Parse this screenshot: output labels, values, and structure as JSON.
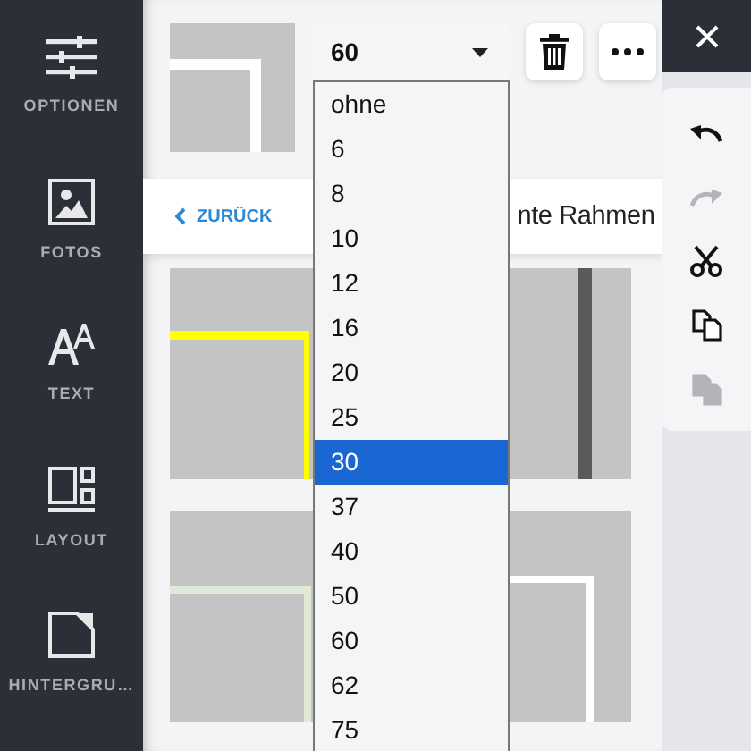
{
  "sidebar": {
    "items": [
      {
        "label": "OPTIONEN"
      },
      {
        "label": "FOTOS"
      },
      {
        "label": "TEXT"
      },
      {
        "label": "LAYOUT"
      },
      {
        "label": "HINTERGRU…"
      }
    ]
  },
  "size_select": {
    "value": "60",
    "options": [
      {
        "label": "ohne",
        "highlighted": false
      },
      {
        "label": "6",
        "highlighted": false
      },
      {
        "label": "8",
        "highlighted": false
      },
      {
        "label": "10",
        "highlighted": false
      },
      {
        "label": "12",
        "highlighted": false
      },
      {
        "label": "16",
        "highlighted": false
      },
      {
        "label": "20",
        "highlighted": false
      },
      {
        "label": "25",
        "highlighted": false
      },
      {
        "label": "30",
        "highlighted": true
      },
      {
        "label": "37",
        "highlighted": false
      },
      {
        "label": "40",
        "highlighted": false
      },
      {
        "label": "50",
        "highlighted": false
      },
      {
        "label": "60",
        "highlighted": false
      },
      {
        "label": "62",
        "highlighted": false
      },
      {
        "label": "75",
        "highlighted": false
      }
    ]
  },
  "back_link": "ZURÜCK",
  "section_title": "nte Rahmen",
  "frames": [
    {
      "color": "#ffff00"
    },
    {
      "color": "#5a5a5a"
    },
    {
      "color": "#e1ead8"
    },
    {
      "color": "#ffffff"
    }
  ],
  "tools": [
    {
      "disabled": false
    },
    {
      "disabled": true
    },
    {
      "disabled": false
    },
    {
      "disabled": false
    },
    {
      "disabled": true
    }
  ]
}
